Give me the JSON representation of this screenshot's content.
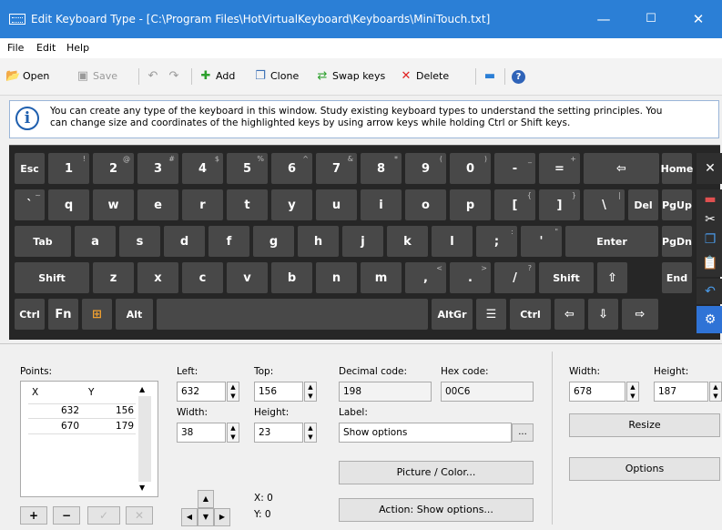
{
  "window": {
    "title": "Edit Keyboard Type - [C:\\Program Files\\HotVirtualKeyboard\\Keyboards\\MiniTouch.txt]",
    "minimize": "—",
    "maximize": "☐",
    "close": "✕",
    "accent": "#2b7fd6"
  },
  "menu": [
    {
      "label": "File"
    },
    {
      "label": "Edit"
    },
    {
      "label": "Help"
    }
  ],
  "toolbar": {
    "open": "Open",
    "save": "Save",
    "add": "Add",
    "clone": "Clone",
    "swap": "Swap keys",
    "delete": "Delete"
  },
  "info": {
    "line1": "You can create any type of the keyboard in this window. Study existing keyboard types to understand the setting principles. You",
    "line2": "can change size and coordinates of the highlighted keys by using arrow keys while holding Ctrl or Shift keys."
  },
  "keyboard": {
    "rows": [
      [
        {
          "m": "Esc",
          "s": ""
        },
        {
          "m": "1",
          "s": "!"
        },
        {
          "m": "2",
          "s": "@"
        },
        {
          "m": "3",
          "s": "#"
        },
        {
          "m": "4",
          "s": "$"
        },
        {
          "m": "5",
          "s": "%"
        },
        {
          "m": "6",
          "s": "^"
        },
        {
          "m": "7",
          "s": "&"
        },
        {
          "m": "8",
          "s": "*"
        },
        {
          "m": "9",
          "s": "("
        },
        {
          "m": "0",
          "s": ")"
        },
        {
          "m": "-",
          "s": "_"
        },
        {
          "m": "=",
          "s": "+"
        },
        {
          "m": "⇦",
          "s": ""
        },
        {
          "m": "Home",
          "s": ""
        }
      ],
      [
        {
          "m": "`",
          "s": "~"
        },
        {
          "m": "q",
          "s": ""
        },
        {
          "m": "w",
          "s": ""
        },
        {
          "m": "e",
          "s": ""
        },
        {
          "m": "r",
          "s": ""
        },
        {
          "m": "t",
          "s": ""
        },
        {
          "m": "y",
          "s": ""
        },
        {
          "m": "u",
          "s": ""
        },
        {
          "m": "i",
          "s": ""
        },
        {
          "m": "o",
          "s": ""
        },
        {
          "m": "p",
          "s": ""
        },
        {
          "m": "[",
          "s": "{"
        },
        {
          "m": "]",
          "s": "}"
        },
        {
          "m": "\\",
          "s": "|"
        },
        {
          "m": "Del",
          "s": ""
        },
        {
          "m": "PgUp",
          "s": ""
        }
      ],
      [
        {
          "m": "Tab",
          "s": ""
        },
        {
          "m": "a",
          "s": ""
        },
        {
          "m": "s",
          "s": ""
        },
        {
          "m": "d",
          "s": ""
        },
        {
          "m": "f",
          "s": ""
        },
        {
          "m": "g",
          "s": ""
        },
        {
          "m": "h",
          "s": ""
        },
        {
          "m": "j",
          "s": ""
        },
        {
          "m": "k",
          "s": ""
        },
        {
          "m": "l",
          "s": ""
        },
        {
          "m": ";",
          "s": ":"
        },
        {
          "m": "'",
          "s": "\""
        },
        {
          "m": "Enter",
          "s": ""
        },
        {
          "m": "PgDn",
          "s": ""
        }
      ],
      [
        {
          "m": "Shift",
          "s": ""
        },
        {
          "m": "z",
          "s": ""
        },
        {
          "m": "x",
          "s": ""
        },
        {
          "m": "c",
          "s": ""
        },
        {
          "m": "v",
          "s": ""
        },
        {
          "m": "b",
          "s": ""
        },
        {
          "m": "n",
          "s": ""
        },
        {
          "m": "m",
          "s": ""
        },
        {
          "m": ",",
          "s": "<"
        },
        {
          "m": ".",
          "s": ">"
        },
        {
          "m": "/",
          "s": "?"
        },
        {
          "m": "Shift",
          "s": ""
        },
        {
          "m": "⇧",
          "s": ""
        },
        {
          "m": "End",
          "s": ""
        }
      ],
      [
        {
          "m": "Ctrl",
          "s": ""
        },
        {
          "m": "Fn",
          "s": ""
        },
        {
          "m": "⊞",
          "s": ""
        },
        {
          "m": "Alt",
          "s": ""
        },
        {
          "m": "",
          "s": ""
        },
        {
          "m": "AltGr",
          "s": ""
        },
        {
          "m": "☰",
          "s": ""
        },
        {
          "m": "Ctrl",
          "s": ""
        },
        {
          "m": "⇦",
          "s": ""
        },
        {
          "m": "⇩",
          "s": ""
        },
        {
          "m": "⇨",
          "s": ""
        }
      ]
    ],
    "side": [
      {
        "icon": "close-icon",
        "g": "✕"
      },
      {
        "icon": "flag-icon",
        "g": "▬"
      },
      {
        "icon": "cut-icon",
        "g": "✂"
      },
      {
        "icon": "copy-icon",
        "g": "❐"
      },
      {
        "icon": "paste-icon",
        "g": "📋"
      },
      {
        "icon": "undo-icon",
        "g": "↶"
      },
      {
        "icon": "settings-icon",
        "g": "⚙"
      }
    ]
  },
  "points": {
    "label": "Points:",
    "col_x": "X",
    "col_y": "Y",
    "rows": [
      [
        "632",
        "156"
      ],
      [
        "670",
        "179"
      ]
    ],
    "add": "+",
    "remove": "−",
    "ok": "✓",
    "cancel": "✕"
  },
  "pos": {
    "left_label": "Left:",
    "left": "632",
    "top_label": "Top:",
    "top": "156",
    "width_label": "Width:",
    "width": "38",
    "height_label": "Height:",
    "height": "23",
    "x": "X: 0",
    "y": "Y: 0"
  },
  "codes": {
    "decimal_label": "Decimal code:",
    "decimal": "198",
    "hex_label": "Hex code:",
    "hex": "00C6",
    "label_label": "Label:",
    "label": "Show options",
    "ellipsis": "...",
    "picture": "Picture / Color...",
    "action": "Action: Show options..."
  },
  "size": {
    "width_label": "Width:",
    "width": "678",
    "height_label": "Height:",
    "height": "187",
    "resize": "Resize",
    "options": "Options"
  }
}
